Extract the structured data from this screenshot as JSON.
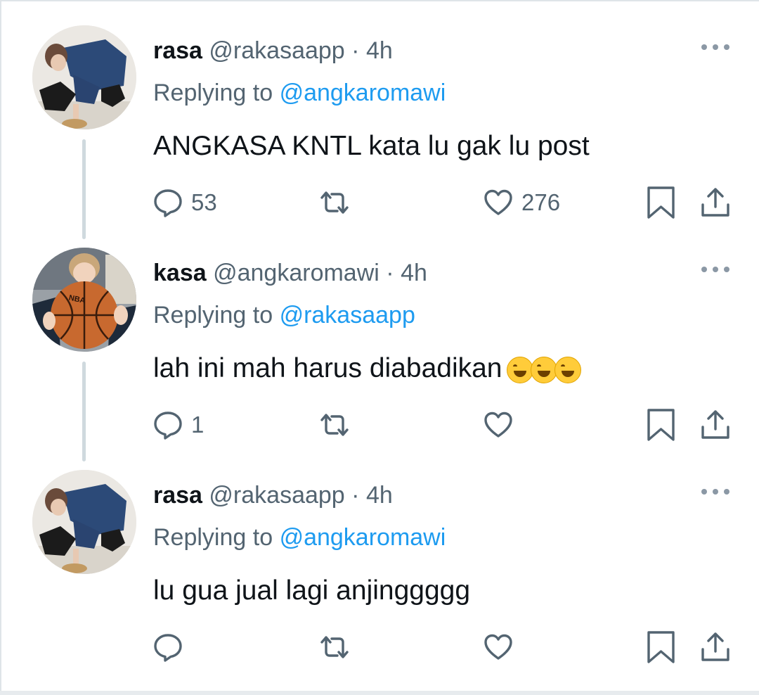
{
  "tweets": [
    {
      "name": "rasa",
      "handle": "@rakasaapp",
      "dot": "·",
      "time": "4h",
      "reply_prefix": "Replying to",
      "reply_to": "@angkaromawi",
      "text": "ANGKASA KNTL kata lu gak lu post",
      "emoji": "",
      "replies": "53",
      "likes": "276"
    },
    {
      "name": "kasa",
      "handle": "@angkaromawi",
      "dot": "·",
      "time": "4h",
      "reply_prefix": "Replying to",
      "reply_to": "@rakasaapp",
      "text": "lah ini mah harus diabadikan",
      "emoji": "😂🤣😂",
      "replies": "1",
      "likes": ""
    },
    {
      "name": "rasa",
      "handle": "@rakasaapp",
      "dot": "·",
      "time": "4h",
      "reply_prefix": "Replying to",
      "reply_to": "@angkaromawi",
      "text": "lu gua jual lagi anjinggggg",
      "emoji": "",
      "replies": "",
      "likes": ""
    }
  ],
  "icons": {
    "reply": "speech-bubble-icon",
    "retweet": "retweet-icon",
    "like": "heart-icon",
    "bookmark": "bookmark-icon",
    "share": "share-icon",
    "more": "more-dots-icon"
  },
  "colors": {
    "text": "#0f1419",
    "secondary": "#536471",
    "link": "#1d9bf0",
    "thread_line": "#cfd9de"
  }
}
